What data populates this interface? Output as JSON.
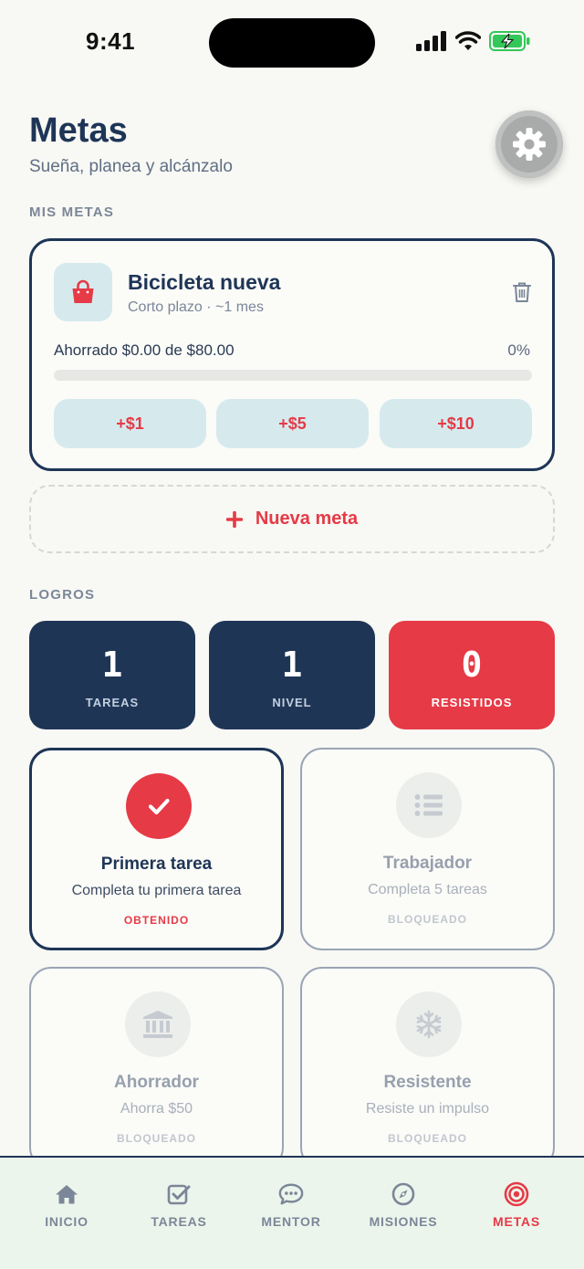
{
  "status_bar": {
    "time": "9:41"
  },
  "header": {
    "title": "Metas",
    "subtitle": "Sueña, planea y alcánzalo",
    "settings_icon": "gear-icon"
  },
  "goals_section": {
    "label": "MIS METAS",
    "goals": [
      {
        "name": "Bicicleta nueva",
        "meta": "Corto plazo · ~1 mes",
        "icon": "shopping-bag-icon",
        "saved_text": "Ahorrado $0.00 de $80.00",
        "percent_text": "0%",
        "progress": 0,
        "quick_add": [
          "+$1",
          "+$5",
          "+$10"
        ]
      }
    ],
    "new_goal_label": "Nueva meta"
  },
  "achievements_section": {
    "label": "LOGROS",
    "stats": [
      {
        "value": "1",
        "label": "TAREAS",
        "color": "#1e3556"
      },
      {
        "value": "1",
        "label": "NIVEL",
        "color": "#1e3556"
      },
      {
        "value": "0",
        "label": "RESISTIDOS",
        "color": "#e63a46"
      }
    ],
    "badges": [
      {
        "title": "Primera tarea",
        "desc": "Completa tu primera tarea",
        "status": "OBTENIDO",
        "icon": "check-icon",
        "earned": true
      },
      {
        "title": "Trabajador",
        "desc": "Completa 5 tareas",
        "status": "BLOQUEADO",
        "icon": "list-icon",
        "earned": false
      },
      {
        "title": "Ahorrador",
        "desc": "Ahorra $50",
        "status": "BLOQUEADO",
        "icon": "bank-icon",
        "earned": false
      },
      {
        "title": "Resistente",
        "desc": "Resiste un impulso",
        "status": "BLOQUEADO",
        "icon": "snowflake-icon",
        "earned": false
      }
    ]
  },
  "tab_bar": {
    "tabs": [
      {
        "label": "INICIO",
        "icon": "home-icon",
        "active": false
      },
      {
        "label": "TAREAS",
        "icon": "checkbox-icon",
        "active": false
      },
      {
        "label": "MENTOR",
        "icon": "chat-icon",
        "active": false
      },
      {
        "label": "MISIONES",
        "icon": "compass-icon",
        "active": false
      },
      {
        "label": "METAS",
        "icon": "target-icon",
        "active": true
      }
    ]
  },
  "colors": {
    "primary": "#1e3556",
    "accent": "#e63a46",
    "background": "#f8f8f4"
  }
}
